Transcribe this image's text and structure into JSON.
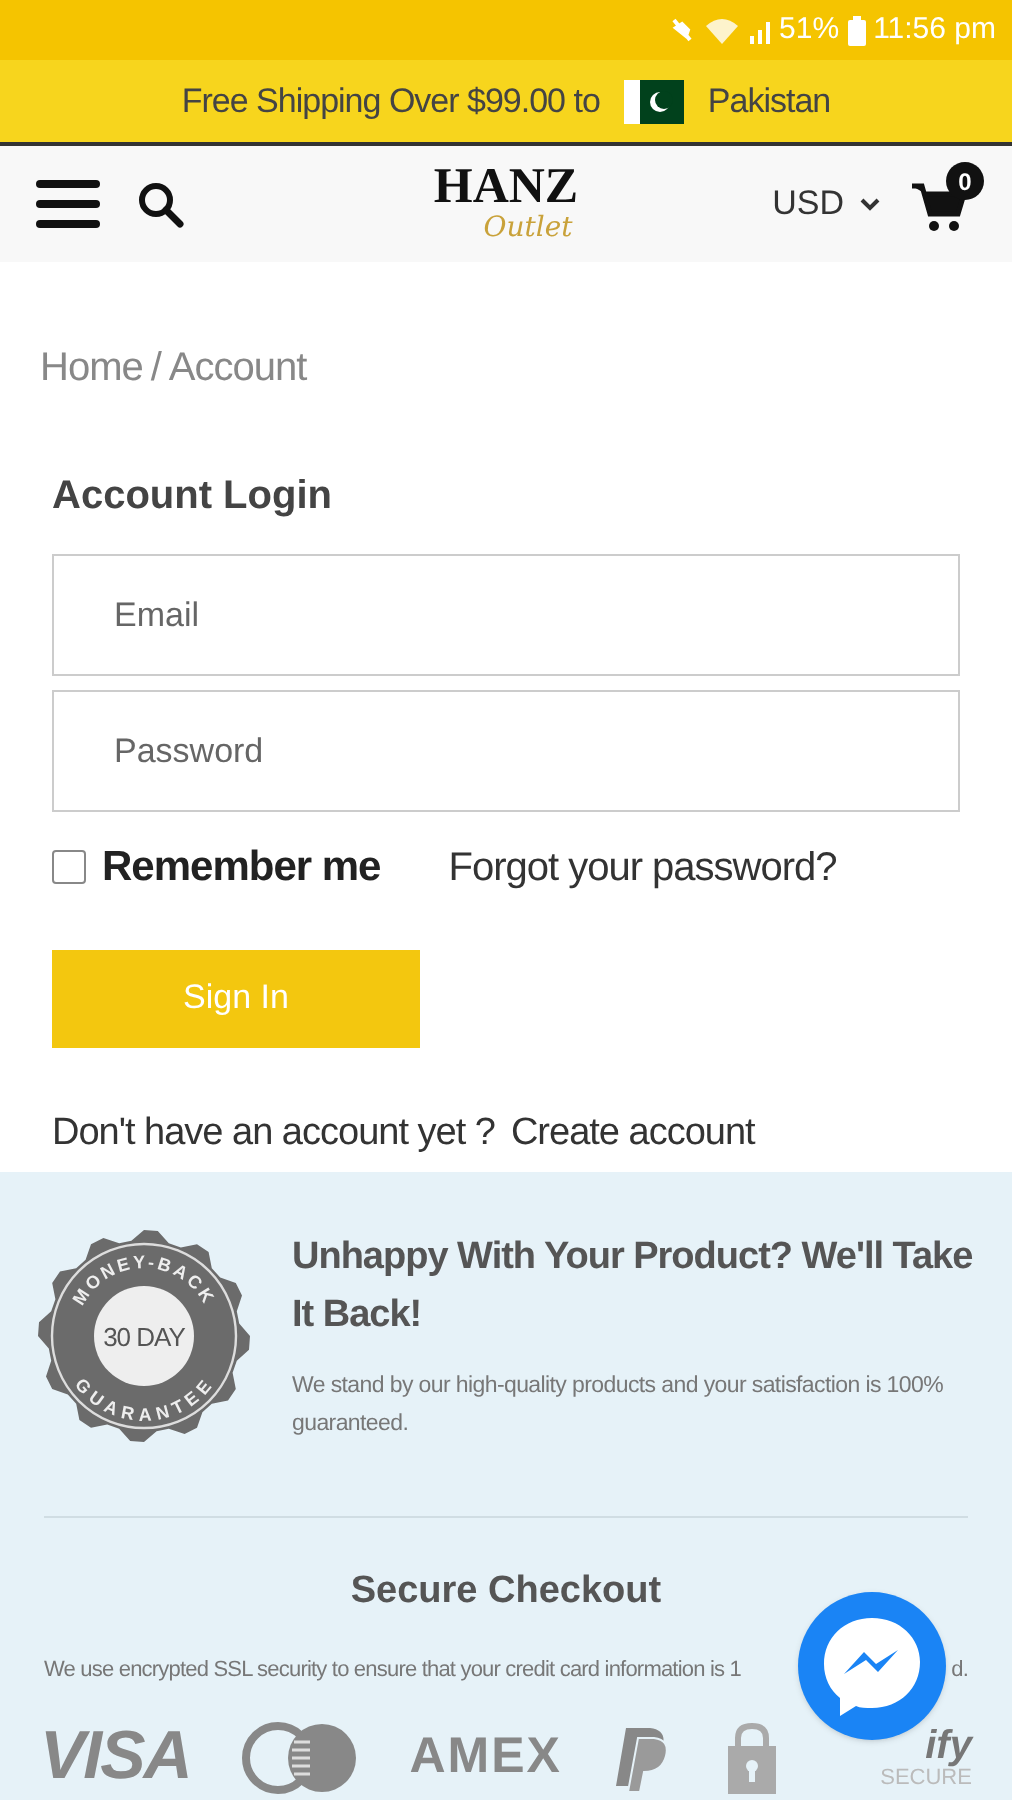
{
  "status_bar": {
    "battery": "51%",
    "time": "11:56 pm"
  },
  "promo_bar": {
    "text": "Free Shipping Over $99.00 to",
    "country": "Pakistan"
  },
  "header": {
    "logo": "HANZ",
    "logo_sub": "Outlet",
    "currency": "USD",
    "cart_count": "0"
  },
  "breadcrumb": [
    {
      "label": "Home"
    },
    {
      "label": "/"
    },
    {
      "label": "Account"
    }
  ],
  "login": {
    "title": "Account Login",
    "email": {
      "placeholder": "Email"
    },
    "password": {
      "placeholder": "Password"
    },
    "remember": {
      "label": "Remember me",
      "checked": false
    },
    "forgot": "Forgot your password?",
    "submit": "Sign In",
    "signup_prompt": "Don't have an account yet ?",
    "signup_link": "Create account"
  },
  "guarantee": {
    "badge_top": "MONEY-BACK",
    "badge_center": "30 DAY",
    "badge_bottom": "GUARANTEE",
    "title": "Unhappy With Your Product? We'll Take It Back!",
    "text": "We stand by our high-quality products and your satisfaction is 100% guaranteed."
  },
  "checkout": {
    "title": "Secure Checkout",
    "text_start": "We use encrypted SSL security to ensure that your credit card information is 1",
    "text_end": "d.",
    "logos": [
      {
        "kind": "visa",
        "text": "VISA"
      },
      {
        "kind": "mastercard"
      },
      {
        "kind": "amex",
        "text": "AMEX"
      },
      {
        "kind": "paypal"
      },
      {
        "kind": "shopify",
        "text": "ify",
        "sub": "SECURE"
      }
    ]
  }
}
